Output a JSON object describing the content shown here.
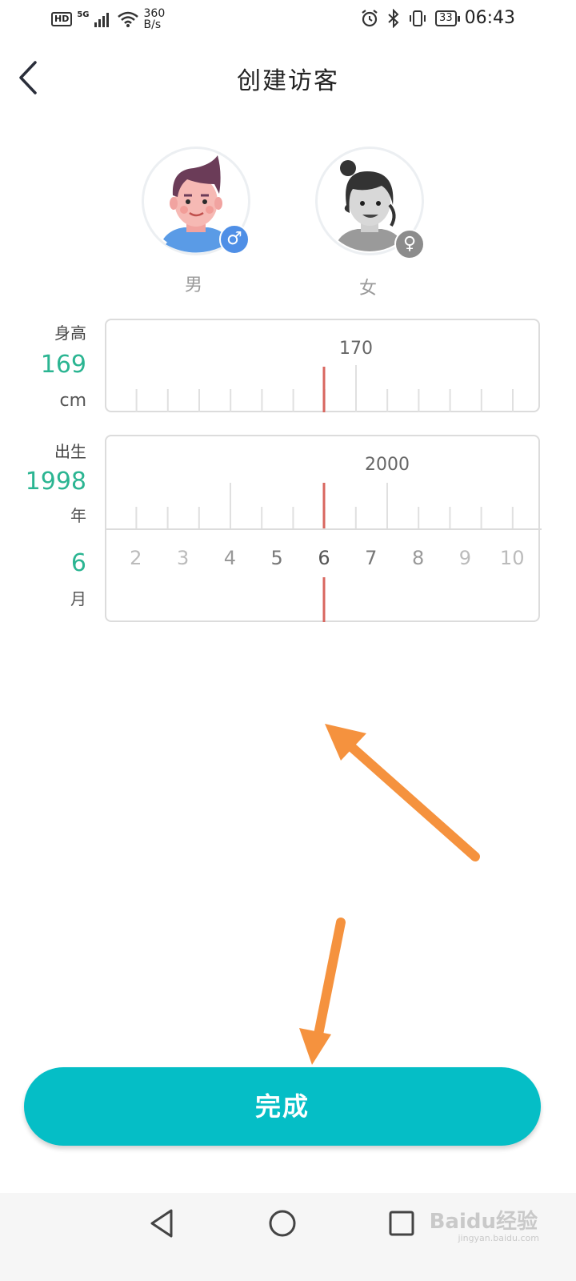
{
  "status_bar": {
    "hd": "HD",
    "network": "5G",
    "speed_value": "360",
    "speed_unit": "B/s",
    "battery": "33",
    "time": "06:43"
  },
  "header": {
    "title": "创建访客",
    "back_icon": "chevron-left-icon"
  },
  "gender": {
    "male_label": "男",
    "female_label": "女",
    "male_symbol": "♂",
    "female_symbol": "♀",
    "selected": "male"
  },
  "height": {
    "label": "身高",
    "value": "169",
    "unit": "cm",
    "ruler_major_label": "170"
  },
  "birth": {
    "label": "出生",
    "year_value": "1998",
    "year_unit": "年",
    "month_value": "6",
    "month_unit": "月",
    "year_ruler_major_label": "2000",
    "month_ticks": [
      "2",
      "3",
      "4",
      "5",
      "6",
      "7",
      "8",
      "9",
      "10"
    ]
  },
  "done_button": "完成",
  "nav": {
    "back_icon": "triangle-back-icon",
    "home_icon": "circle-home-icon",
    "recents_icon": "square-recents-icon"
  },
  "watermark": {
    "text": "Baidu经验",
    "sub": "jingyan.baidu.com"
  },
  "colors": {
    "accent": "#05bec6",
    "value_green": "#2bb592",
    "indicator_red": "#d9665f",
    "arrow_orange": "#f5923e",
    "male_badge": "#4f8fe6"
  }
}
